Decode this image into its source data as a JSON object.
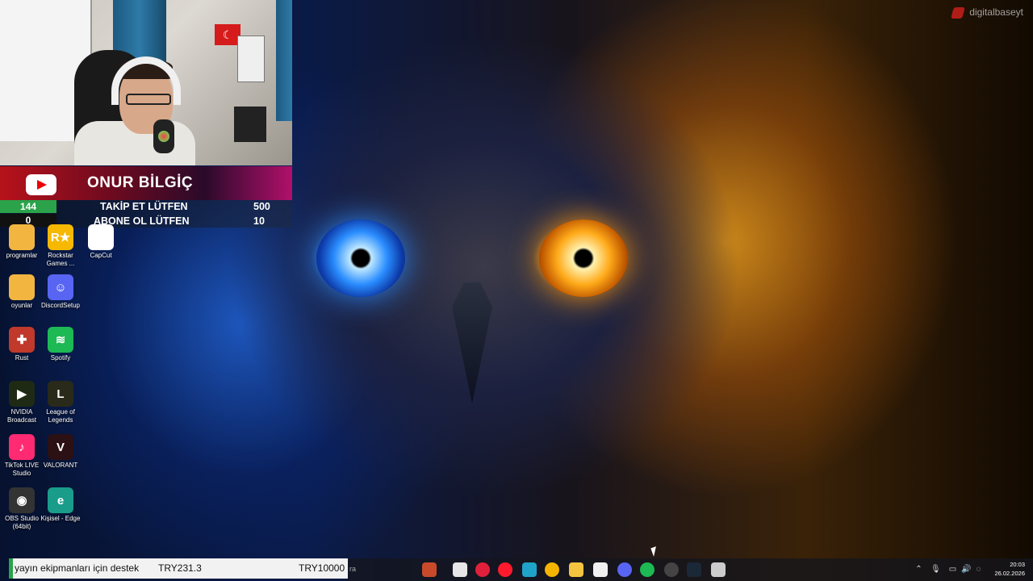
{
  "overlay": {
    "channel_name": "ONUR BİLGİÇ",
    "goals": [
      {
        "count": "144",
        "label": "TAKİP ET LÜTFEN",
        "target": "500"
      },
      {
        "count": "0",
        "label": "ABONE OL LÜTFEN",
        "target": "10"
      }
    ]
  },
  "desktop_icons": [
    {
      "label": "programlar",
      "icon": "folder-icon",
      "color": "#f2b640",
      "glyph": ""
    },
    {
      "label": "Rockstar Games ...",
      "icon": "rockstar-icon",
      "color": "#f6b800",
      "glyph": "R★"
    },
    {
      "label": "CapCut",
      "icon": "capcut-icon",
      "color": "#ffffff",
      "glyph": ""
    },
    {
      "label": "oyunlar",
      "icon": "folder-icon",
      "color": "#f2b640",
      "glyph": ""
    },
    {
      "label": "DiscordSetup",
      "icon": "discord-icon",
      "color": "#5865f2",
      "glyph": "☺"
    },
    {
      "label": "Rust",
      "icon": "rust-icon",
      "color": "#c0392b",
      "glyph": "✚"
    },
    {
      "label": "Spotify",
      "icon": "spotify-icon",
      "color": "#1db954",
      "glyph": "≋"
    },
    {
      "label": "NVIDIA Broadcast",
      "icon": "nvidia-icon",
      "color": "#1f2a14",
      "glyph": "▶"
    },
    {
      "label": "League of Legends",
      "icon": "league-icon",
      "color": "#2a2a1a",
      "glyph": "L"
    },
    {
      "label": "TikTok LIVE Studio",
      "icon": "tiktok-icon",
      "color": "#ff2a72",
      "glyph": "♪"
    },
    {
      "label": "VALORANT",
      "icon": "valorant-icon",
      "color": "#2b1014",
      "glyph": "V"
    },
    {
      "label": "OBS Studio (64bit)",
      "icon": "obs-icon",
      "color": "#333333",
      "glyph": "◉"
    },
    {
      "label": "Kişisel - Edge",
      "icon": "edge-icon",
      "color": "#1a9c8a",
      "glyph": "e"
    }
  ],
  "donation": {
    "message": "yayın ekipmanları için destek",
    "current": "TRY231.3",
    "goal": "TRY10000"
  },
  "taskbar": {
    "search_hint": "ra",
    "apps": [
      {
        "icon": "lightshot-icon",
        "color": "#c84a2a"
      },
      {
        "icon": "file-icon",
        "color": "#e6e6e6"
      },
      {
        "icon": "opera-gx-icon",
        "color": "#e0203a"
      },
      {
        "icon": "opera-icon",
        "color": "#ff1b2d"
      },
      {
        "icon": "edge-icon",
        "color": "#1fa3c8"
      },
      {
        "icon": "chrome-icon",
        "color": "#f4b400"
      },
      {
        "icon": "file-explorer-icon",
        "color": "#f2c440"
      },
      {
        "icon": "store-icon",
        "color": "#f0f0f0"
      },
      {
        "icon": "discord-icon",
        "color": "#5865f2"
      },
      {
        "icon": "spotify-icon",
        "color": "#1db954"
      },
      {
        "icon": "obs-icon",
        "color": "#444444"
      },
      {
        "icon": "steam-icon",
        "color": "#1b2838"
      },
      {
        "icon": "settings-icon",
        "color": "#cccccc"
      }
    ],
    "clock_time": "20:03",
    "clock_date": "26.02.2026"
  },
  "watermark": "digitalbaseyt"
}
